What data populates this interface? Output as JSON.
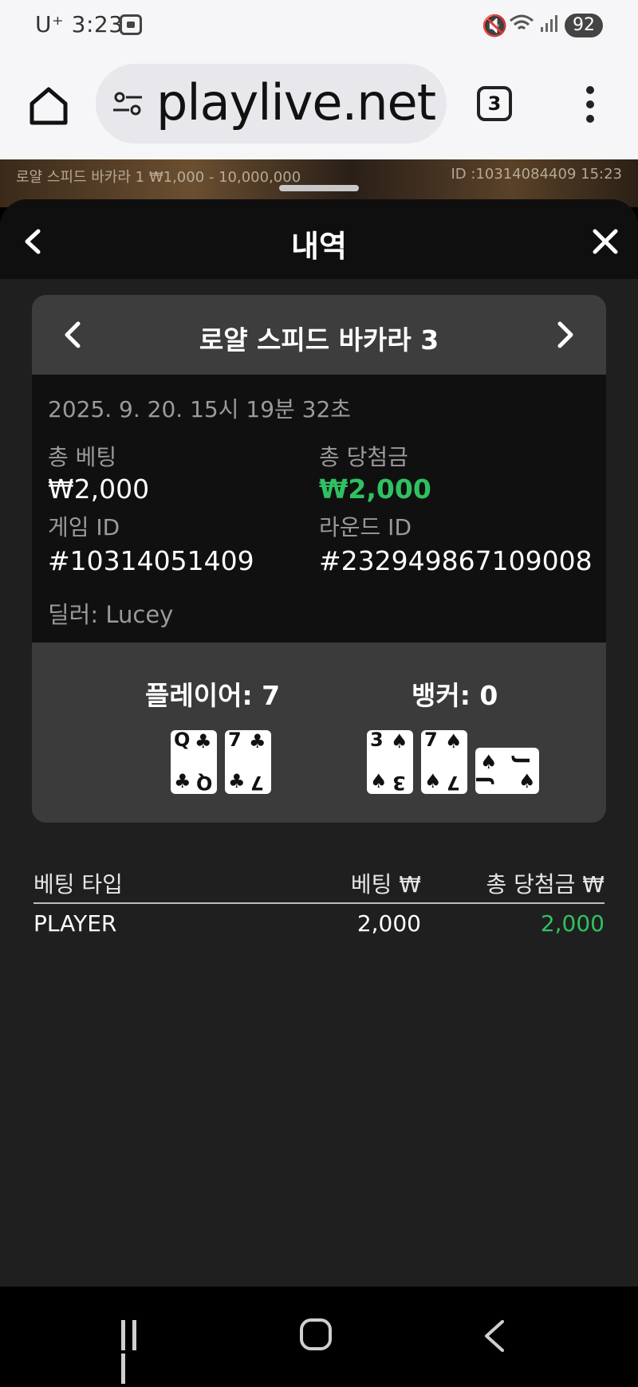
{
  "status_bar": {
    "carrier": "U⁺ 3:23",
    "battery": "92"
  },
  "browser": {
    "url": "playlive.net",
    "tab_count": "3"
  },
  "game_bg": {
    "table_info": "로얄 스피드 바카라 1 ₩1,000 - 10,000,000",
    "id_time": "ID :10314084409 15:23"
  },
  "modal": {
    "title": "내역",
    "game_name": "로얄 스피드 바카라 3",
    "datetime": "2025. 9. 20. 15시 19분 32초",
    "total_bet_label": "총 베팅",
    "total_bet_value": "₩2,000",
    "total_win_label": "총 당첨금",
    "total_win_value": "₩2,000",
    "game_id_label": "게임 ID",
    "game_id_value": "#10314051409",
    "round_id_label": "라운드 ID",
    "round_id_value": "#232949867109008",
    "dealer": "딜러: Lucey",
    "player_label": "플레이어: 7",
    "banker_label": "뱅커: 0",
    "player_cards": [
      {
        "rank": "Q",
        "suit": "♣"
      },
      {
        "rank": "7",
        "suit": "♣"
      }
    ],
    "banker_cards": [
      {
        "rank": "3",
        "suit": "♠"
      },
      {
        "rank": "7",
        "suit": "♠"
      },
      {
        "rank": "J",
        "suit": "♠"
      }
    ],
    "table_headers": [
      "베팅 타입",
      "베팅 ₩",
      "총 당첨금 ₩"
    ],
    "rows": [
      {
        "type": "PLAYER",
        "bet": "2,000",
        "win": "2,000"
      }
    ]
  },
  "colors": {
    "win_green": "#2fc161",
    "modal_bg": "#1f1f1f"
  },
  "icons": [
    "home-icon",
    "tune-icon",
    "more-vert-icon",
    "back-icon",
    "close-icon",
    "chevron-left-icon",
    "chevron-right-icon"
  ]
}
